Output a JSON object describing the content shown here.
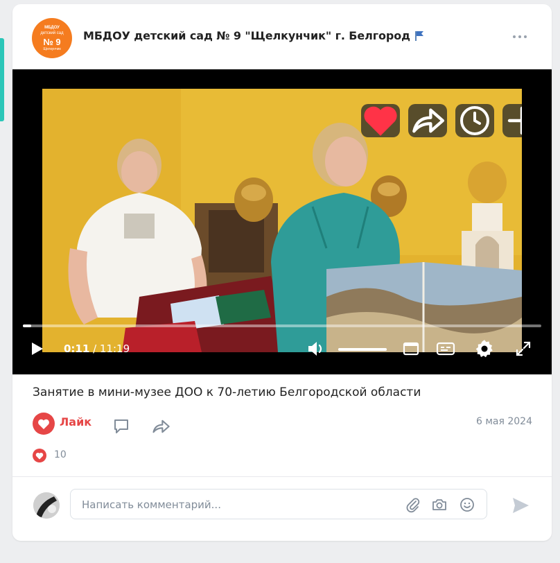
{
  "post": {
    "group": {
      "name": "МБДОУ детский сад № 9 \"Щелкунчик\" г. Белгород",
      "avatar_lines": [
        "МБДОУ",
        "детский сад",
        "№ 9",
        "Щелкунчик"
      ]
    },
    "video": {
      "time_current": "0:11",
      "time_separator": " / ",
      "time_total": "11:19",
      "progress_fraction": 0.016,
      "volume_fraction": 1.0
    },
    "caption": "Занятие в мини-музее ДОО к 70-летию Белгородской области",
    "actions": {
      "like_label": "Лайк",
      "likes_count": "10",
      "date": "6 мая 2024"
    },
    "comment": {
      "placeholder": "Написать комментарий..."
    }
  },
  "colors": {
    "accent_red": "#e64646",
    "brand_orange": "#f57c1f",
    "muted": "#818c99",
    "teal_edge": "#2bc6b8"
  },
  "icons": {
    "video_overlay": [
      "heart-icon",
      "share-icon",
      "clock-icon",
      "plus-icon"
    ],
    "video_controls": [
      "play-icon",
      "volume-icon",
      "miniplayer-icon",
      "subtitles-icon",
      "settings-icon",
      "fullscreen-icon"
    ],
    "post_actions": [
      "heart-icon",
      "comment-icon",
      "share-icon"
    ],
    "comment_box": [
      "attach-icon",
      "camera-icon",
      "emoji-icon",
      "send-icon"
    ]
  }
}
